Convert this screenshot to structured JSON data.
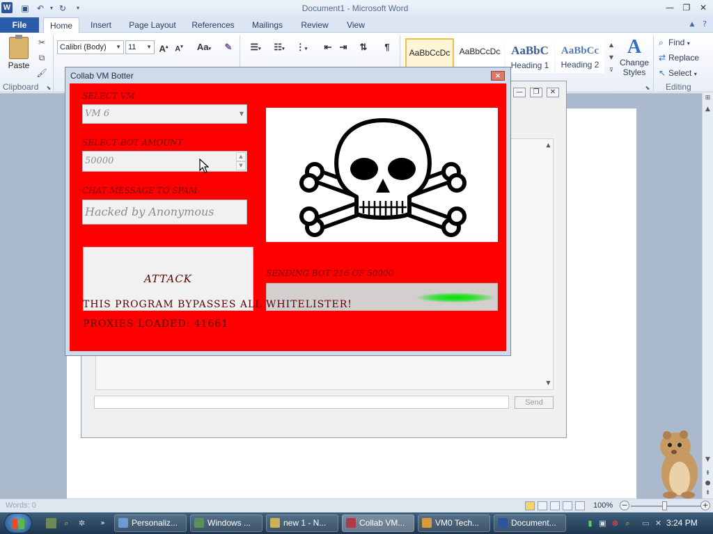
{
  "word": {
    "title": "Document1 - Microsoft Word",
    "file_tab": "File",
    "tabs": [
      "Home",
      "Insert",
      "Page Layout",
      "References",
      "Mailings",
      "Review",
      "View"
    ],
    "paste_label": "Paste",
    "clipboard_label": "Clipboard",
    "font_name": "Calibri (Body)",
    "font_size": "11",
    "styles": [
      {
        "sample": "AaBbCcDc",
        "name": ""
      },
      {
        "sample": "AaBbCcDc",
        "name": ""
      },
      {
        "sample": "AaBbC",
        "name": "Heading 1"
      },
      {
        "sample": "AaBbCc",
        "name": "Heading 2"
      }
    ],
    "change_styles_1": "Change",
    "change_styles_2": "Styles",
    "editing": {
      "find": "Find",
      "replace": "Replace",
      "select": "Select",
      "label": "Editing"
    },
    "status": {
      "words": "Words: 0",
      "zoom": "100%"
    }
  },
  "chat_window": {
    "send_label": "Send"
  },
  "bot": {
    "title": "Collab VM Botter",
    "select_vm_label": "SELECT VM",
    "vm_value": "VM 6",
    "bot_amount_label": "SELECT BOT AMOUNT",
    "bot_amount_value": "50000",
    "chat_label": "CHAT MESSAGE TO SPAM",
    "chat_value": "Hacked by Anonymous",
    "attack_label": "ATTACK",
    "progress_text": "SENDING BOT 216 OF 50000",
    "progress_fraction": 0.0043,
    "footer_1": "THIS PROGRAM BYPASSES ALL WHITELISTER!",
    "footer_2": "PROXIES LOADED: 41661"
  },
  "taskbar": {
    "buttons": [
      {
        "label": "Personaliz...",
        "color": "#6a9bd1"
      },
      {
        "label": "Windows ...",
        "color": "#5b8f5b"
      },
      {
        "label": "new 1 - N...",
        "color": "#c9b25a"
      },
      {
        "label": "Collab VM...",
        "color": "#b03a4a"
      },
      {
        "label": "VM0 Tech...",
        "color": "#d99a3a"
      },
      {
        "label": "Document...",
        "color": "#2b579a"
      }
    ],
    "clock": "3:24 PM"
  },
  "colors": {
    "bot_background": "#ff0000",
    "progress_fill": "#00e000",
    "word_file_tab": "#2a5caa"
  }
}
